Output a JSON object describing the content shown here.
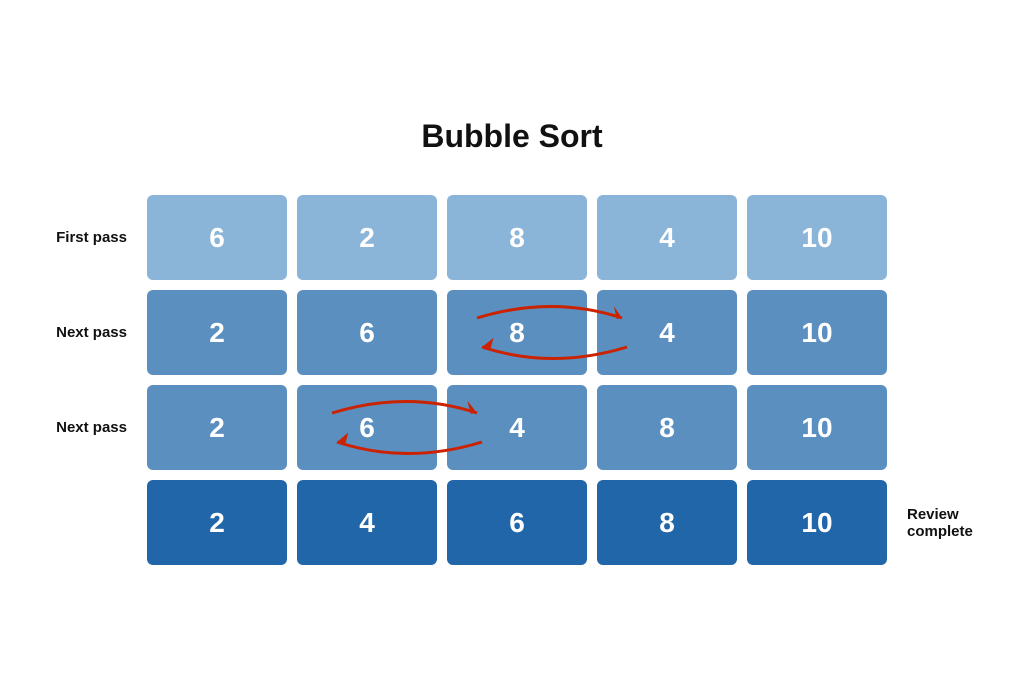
{
  "title": "Bubble Sort",
  "rows": [
    {
      "label": "First pass",
      "suffix": "",
      "cells": [
        6,
        2,
        8,
        4,
        10
      ],
      "style": "light",
      "arrows": null
    },
    {
      "label": "Next pass",
      "suffix": "",
      "cells": [
        2,
        6,
        8,
        4,
        10
      ],
      "style": "medium",
      "arrows": {
        "from": 2,
        "to": 3
      }
    },
    {
      "label": "Next pass",
      "suffix": "",
      "cells": [
        2,
        6,
        4,
        8,
        10
      ],
      "style": "medium",
      "arrows": {
        "from": 1,
        "to": 2
      }
    },
    {
      "label": "",
      "suffix": "Review\ncomplete",
      "cells": [
        2,
        4,
        6,
        8,
        10
      ],
      "style": "dark",
      "arrows": null
    }
  ]
}
